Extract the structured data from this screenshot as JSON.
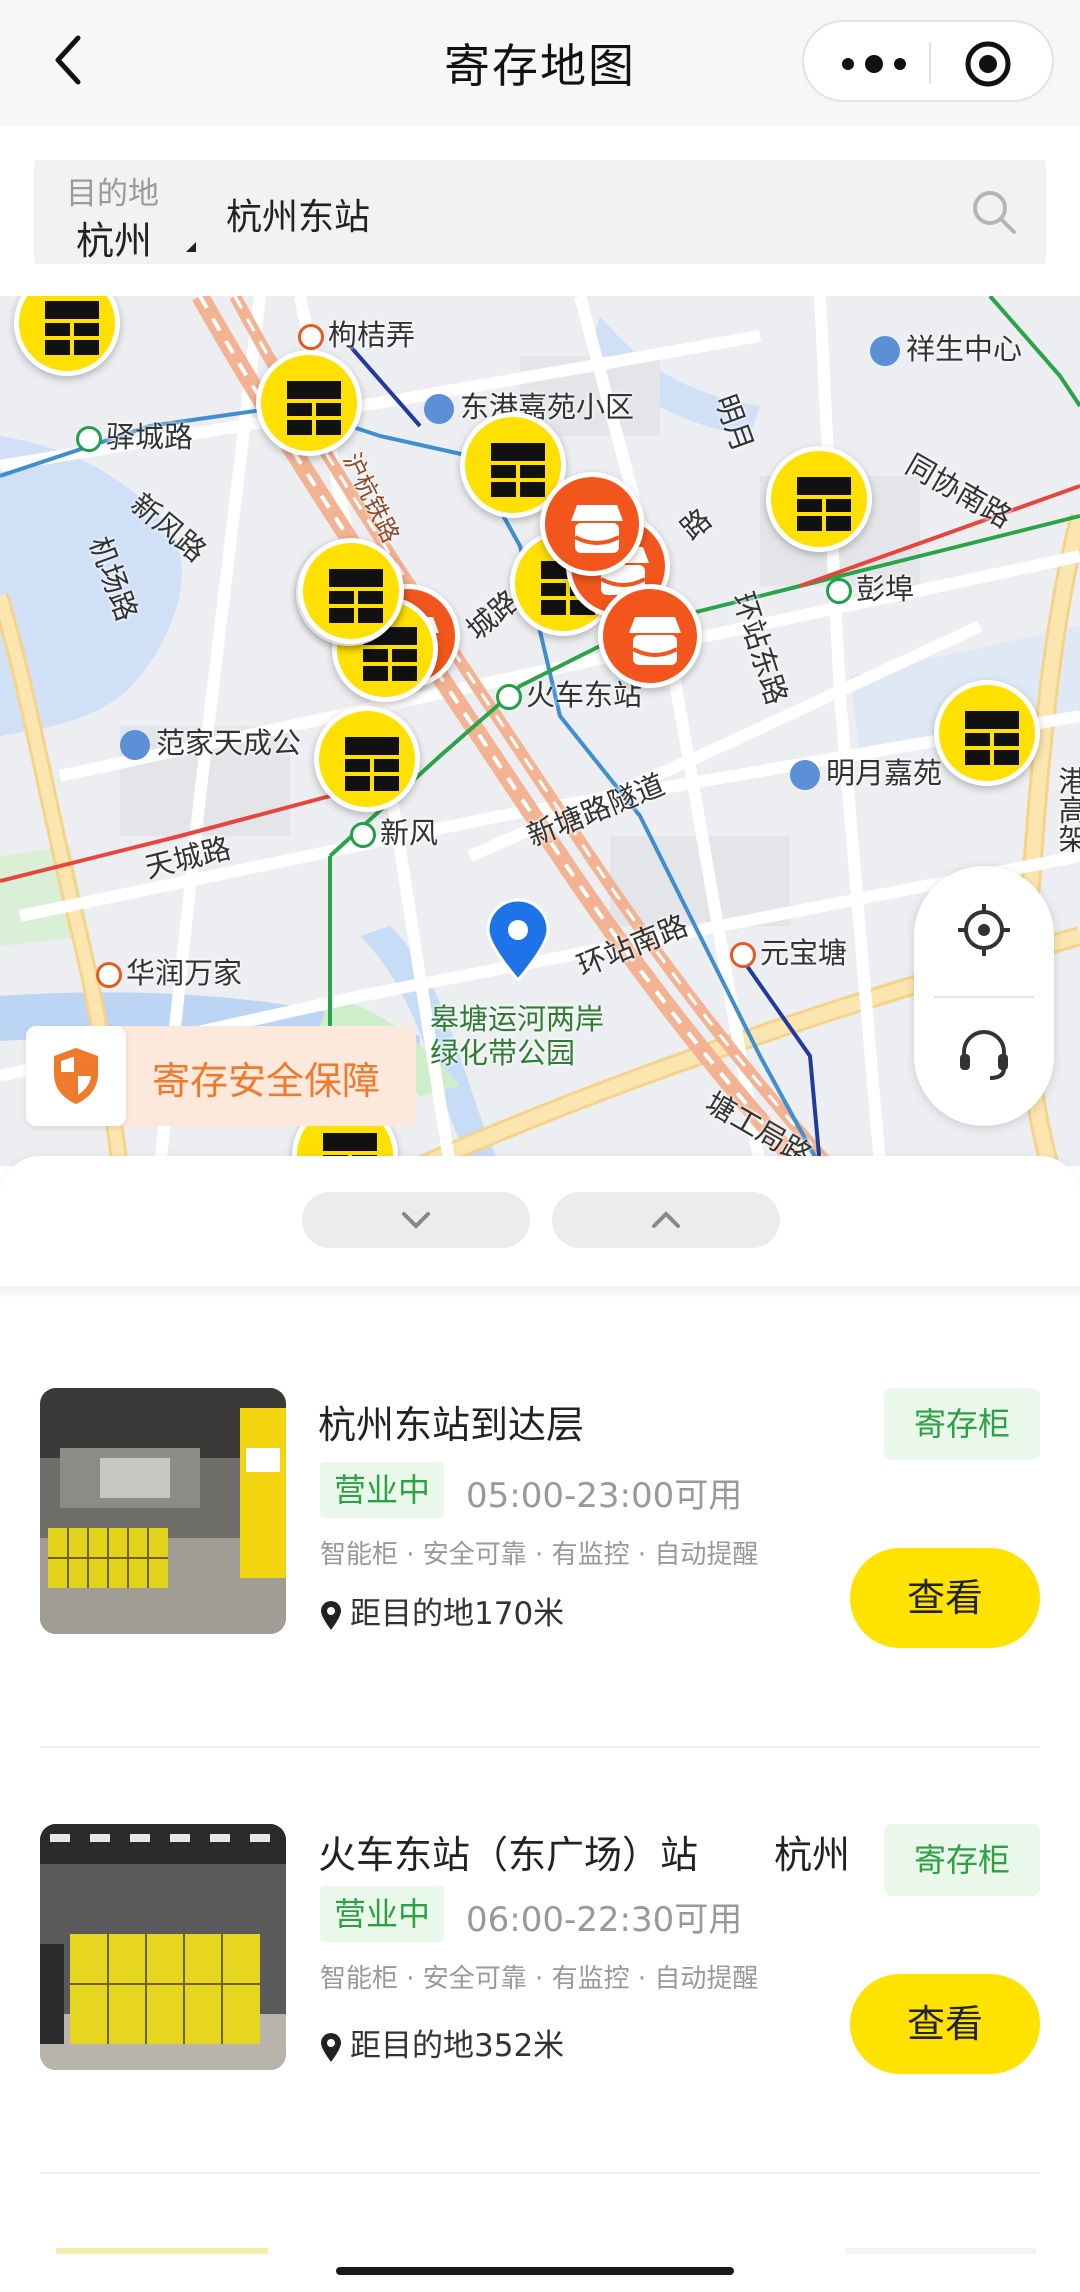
{
  "nav": {
    "title": "寄存地图"
  },
  "search": {
    "dest_label": "目的地",
    "city": "杭州",
    "value": "杭州东站"
  },
  "map": {
    "labels": {
      "goujinong": "枸桔弄",
      "xiangsheng": "祥生中心",
      "donggang": "东港嘉苑小区",
      "yicheng": "驿城路",
      "mingyue_road": "明月",
      "tongxie": "同协南路",
      "xinfeng_road": "新风路",
      "jichang": "机场路",
      "hangbo": "沪杭铁路",
      "huanzhan_east": "环站东路",
      "pengbu": "彭埠",
      "huochedong": "火车东站",
      "fanjia": "范家天成公",
      "mingyuejia": "明月嘉苑",
      "xintang": "新塘路隧道",
      "tiancheng": "天城路",
      "xinfeng": "新风",
      "huanzhan_south": "环站南路",
      "yuanbao": "元宝塘",
      "huarun": "华润万家",
      "gaotang": "皋塘运河两岸",
      "lvhua": "绿化带公园",
      "tanggong": "塘工局路",
      "gangao": "港高架",
      "chenglu": "城路",
      "road_lu": "路"
    },
    "safety_text": "寄存安全保障"
  },
  "list": [
    {
      "title": "杭州东站到达层",
      "status": "营业中",
      "hours": "05:00-23:00可用",
      "tags": "智能柜 · 安全可靠 · 有监控 · 自动提醒",
      "distance": "距目的地170米",
      "badge": "寄存柜",
      "button": "查看"
    },
    {
      "title": "火车东站（东广场）站　　杭州",
      "status": "营业中",
      "hours": "06:00-22:30可用",
      "tags": "智能柜 · 安全可靠 · 有监控 · 自动提醒",
      "distance": "距目的地352米",
      "badge": "寄存柜",
      "button": "查看"
    }
  ],
  "colors": {
    "accent_yellow": "#ffe300",
    "status_green": "#2ea043",
    "shop_orange": "#f2561d",
    "safety_orange": "#f07a2c"
  }
}
